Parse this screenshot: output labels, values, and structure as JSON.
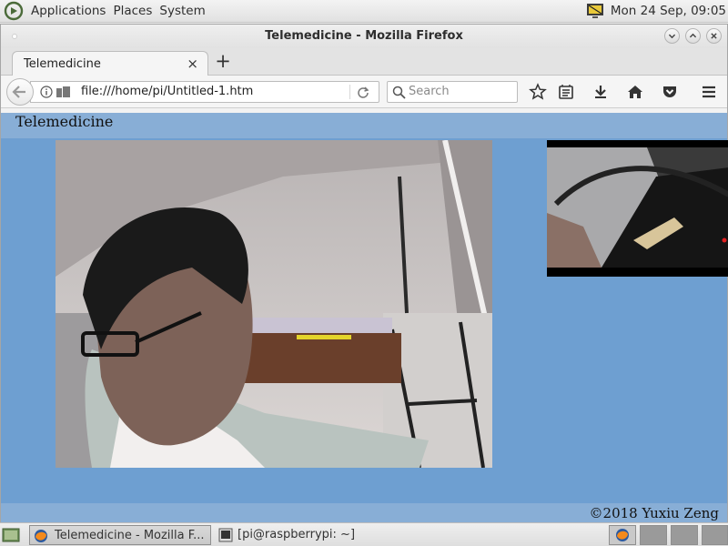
{
  "panel": {
    "menus": [
      "Applications",
      "Places",
      "System"
    ],
    "clock": "Mon 24 Sep, 09:05"
  },
  "window": {
    "title": "Telemedicine - Mozilla Firefox"
  },
  "tab": {
    "label": "Telemedicine",
    "close": "×",
    "new_tab": "+"
  },
  "navbar": {
    "url": "file:///home/pi/Untitled-1.htm",
    "search_placeholder": "Search"
  },
  "page": {
    "title": "Telemedicine",
    "footer": "©2018 Yuxiu Zeng"
  },
  "taskbar": {
    "firefox_task": "Telemedicine - Mozilla F...",
    "terminal_task": "[pi@raspberrypi: ~]"
  },
  "colors": {
    "page_bg": "#6e9fd1",
    "header_footer_bg": "#88aed6"
  }
}
